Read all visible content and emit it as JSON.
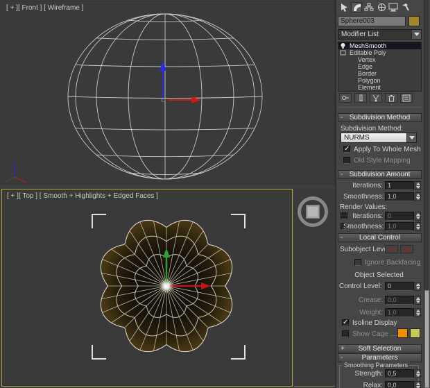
{
  "viewports": {
    "front": {
      "label": "[ + ][ Front ] [ Wireframe ]"
    },
    "top": {
      "label": "[ + ][ Top ] [ Smooth + Highlights + Edged Faces ]"
    }
  },
  "panel": {
    "object_name": "Sphere003",
    "modifier_list_label": "Modifier List",
    "stack": [
      {
        "label": "MeshSmooth"
      },
      {
        "label": "Editable Poly"
      },
      {
        "label": "Vertex"
      },
      {
        "label": "Edge"
      },
      {
        "label": "Border"
      },
      {
        "label": "Polygon"
      },
      {
        "label": "Element"
      }
    ],
    "rollouts": {
      "subdivision_method": {
        "title": "Subdivision Method",
        "method_label": "Subdivision Method:",
        "method_value": "NURMS",
        "apply_whole_mesh": "Apply To Whole Mesh",
        "old_style_mapping": "Old Style Mapping"
      },
      "subdivision_amount": {
        "title": "Subdivision Amount",
        "iterations_label": "Iterations:",
        "iterations_value": "1",
        "smoothness_label": "Smoothness:",
        "smoothness_value": "1,0",
        "render_values_label": "Render Values:",
        "render_iterations_value": "0",
        "render_smoothness_value": "1,0"
      },
      "local_control": {
        "title": "Local Control",
        "subobject_level_label": "Subobject Level:",
        "ignore_backfacing": "Ignore Backfacing",
        "object_selected": "Object Selected",
        "control_level_label": "Control Level:",
        "control_level_value": "0",
        "crease_label": "Crease:",
        "crease_value": "0,0",
        "weight_label": "Weight:",
        "weight_value": "1,0",
        "isoline_display": "Isoline Display",
        "show_cage": "Show Cage ......"
      },
      "soft_selection": {
        "title": "Soft Selection"
      },
      "parameters": {
        "title": "Parameters",
        "group_title": "Smoothing Parameters",
        "strength_label": "Strength:",
        "strength_value": "0,5",
        "relax_label": "Relax:",
        "relax_value": "0,0"
      }
    },
    "colors": {
      "object_swatch": "#a3872b",
      "cage_swatch_1": "#f08c00",
      "cage_swatch_2": "#c3c857",
      "active_viewport_border": "#b5a53f"
    }
  }
}
